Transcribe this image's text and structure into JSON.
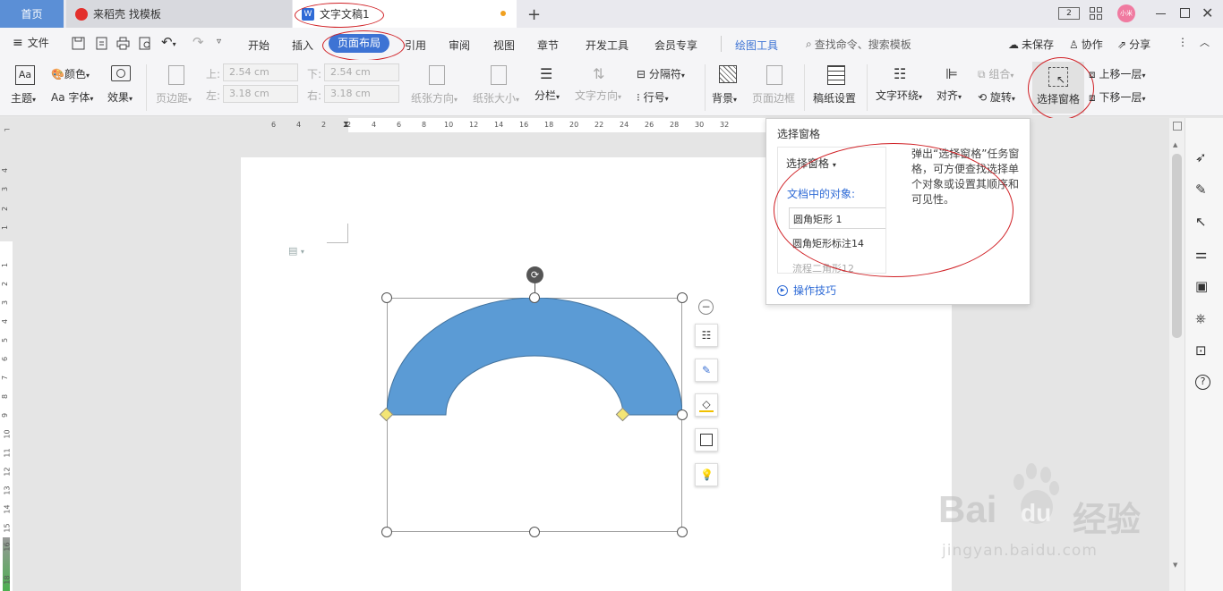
{
  "tabs": {
    "home": "首页",
    "docer": "来稻壳 找模板",
    "document": "文字文稿1",
    "window_count": "2",
    "avatar": "小米"
  },
  "toolbar": {
    "file": "文件",
    "menus": [
      "开始",
      "插入",
      "页面布局",
      "引用",
      "审阅",
      "视图",
      "章节",
      "开发工具",
      "会员专享"
    ],
    "drawing_tools": "绘图工具",
    "search_placeholder": "查找命令、搜索模板",
    "unsaved": "未保存",
    "collaborate": "协作",
    "share": "分享"
  },
  "ribbon": {
    "theme": "主题",
    "color": "颜色",
    "font": "字体",
    "effect": "效果",
    "margins": "页边距",
    "top_label": "上:",
    "top_value": "2.54 cm",
    "bottom_label": "下:",
    "bottom_value": "2.54 cm",
    "left_label": "左:",
    "left_value": "3.18 cm",
    "right_label": "右:",
    "right_value": "3.18 cm",
    "orientation": "纸张方向",
    "paper_size": "纸张大小",
    "columns": "分栏",
    "text_direction": "文字方向",
    "breaks": "分隔符",
    "line_numbers": "行号",
    "background": "背景",
    "page_border": "页面边框",
    "manuscript": "稿纸设置",
    "text_wrap": "文字环绕",
    "align": "对齐",
    "group": "组合",
    "rotate": "旋转",
    "selection_pane": "选择窗格",
    "bring_forward": "上移一层",
    "send_backward": "下移一层"
  },
  "ruler": {
    "h_ticks": [
      "6",
      "4",
      "2",
      "2",
      "4",
      "6",
      "8",
      "10",
      "12",
      "14",
      "16",
      "18",
      "20",
      "22",
      "24",
      "26",
      "28",
      "30",
      "32"
    ],
    "v_ticks": [
      "4",
      "3",
      "2",
      "1",
      "1",
      "2",
      "3",
      "4",
      "5",
      "6",
      "7",
      "8",
      "9",
      "10",
      "11",
      "12",
      "13",
      "14",
      "15",
      "16",
      "18"
    ]
  },
  "popup": {
    "title": "选择窗格",
    "preview_header": "选择窗格",
    "objects_label": "文档中的对象:",
    "item1": "圆角矩形 1",
    "item2": "圆角矩形标注14",
    "item3": "流程二角形12",
    "description": "弹出“选择窗格”任务窗格，可方便查找选择单个对象或设置其顺序和可见性。",
    "tips": "操作技巧"
  },
  "watermark": {
    "brand_left": "Bai",
    "brand_right": "du",
    "brand_cn": "经验",
    "url": "jingyan.baidu.com"
  },
  "colors": {
    "shape_fill": "#5b9bd5",
    "accent_blue": "#3d73d4",
    "annotation_red": "#d01f24"
  }
}
